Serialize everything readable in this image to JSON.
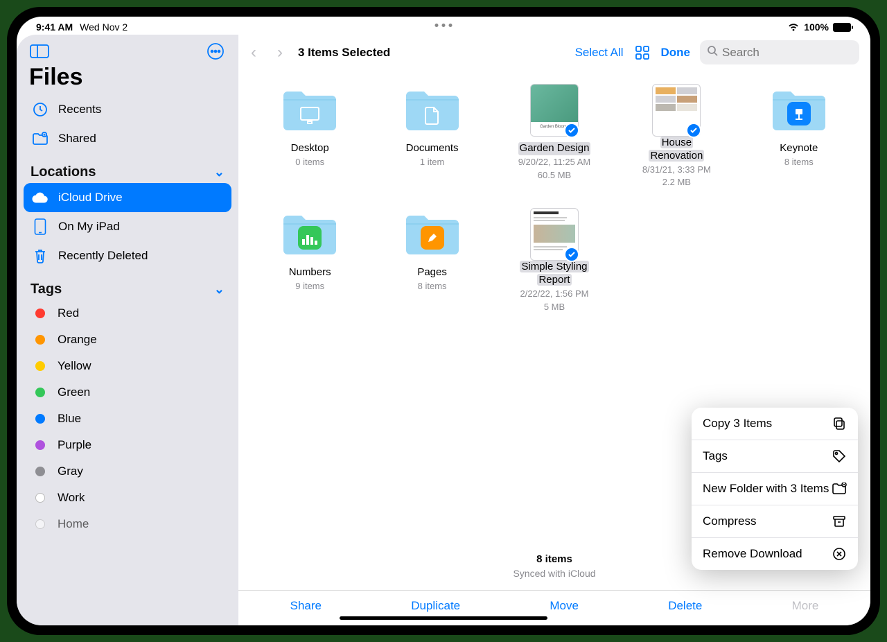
{
  "status": {
    "time": "9:41 AM",
    "date": "Wed Nov 2",
    "battery": "100%"
  },
  "sidebar": {
    "title": "Files",
    "recents": "Recents",
    "shared": "Shared",
    "locations_header": "Locations",
    "locations": {
      "icloud": "iCloud Drive",
      "onmyipad": "On My iPad",
      "deleted": "Recently Deleted"
    },
    "tags_header": "Tags",
    "tags": [
      {
        "label": "Red",
        "color": "#ff3b30"
      },
      {
        "label": "Orange",
        "color": "#ff9500"
      },
      {
        "label": "Yellow",
        "color": "#ffcc00"
      },
      {
        "label": "Green",
        "color": "#34c759"
      },
      {
        "label": "Blue",
        "color": "#007aff"
      },
      {
        "label": "Purple",
        "color": "#af52de"
      },
      {
        "label": "Gray",
        "color": "#8e8e93"
      },
      {
        "label": "Work",
        "color": "#ffffff"
      },
      {
        "label": "Home",
        "color": "#ffffff"
      }
    ]
  },
  "toolbar": {
    "title": "3 Items Selected",
    "select_all": "Select All",
    "done": "Done",
    "search_placeholder": "Search"
  },
  "files": {
    "desktop": {
      "name": "Desktop",
      "meta": "0 items"
    },
    "documents": {
      "name": "Documents",
      "meta": "1 item"
    },
    "garden": {
      "name": "Garden Design",
      "meta1": "9/20/22, 11:25 AM",
      "meta2": "60.5 MB"
    },
    "house": {
      "name1": "House",
      "name2": "Renovation",
      "meta1": "8/31/21, 3:33 PM",
      "meta2": "2.2 MB"
    },
    "keynote": {
      "name": "Keynote",
      "meta": "8 items"
    },
    "numbers": {
      "name": "Numbers",
      "meta": "9 items"
    },
    "pages": {
      "name": "Pages",
      "meta": "8 items"
    },
    "styling": {
      "name1": "Simple Styling",
      "name2": "Report",
      "meta1": "2/22/22, 1:56 PM",
      "meta2": "5 MB"
    }
  },
  "footer": {
    "count": "8 items",
    "sync": "Synced with iCloud"
  },
  "actions": {
    "share": "Share",
    "duplicate": "Duplicate",
    "move": "Move",
    "delete": "Delete",
    "more": "More"
  },
  "popover": {
    "copy": "Copy 3 Items",
    "tags": "Tags",
    "newfolder": "New Folder with 3 Items",
    "compress": "Compress",
    "remove": "Remove Download"
  }
}
